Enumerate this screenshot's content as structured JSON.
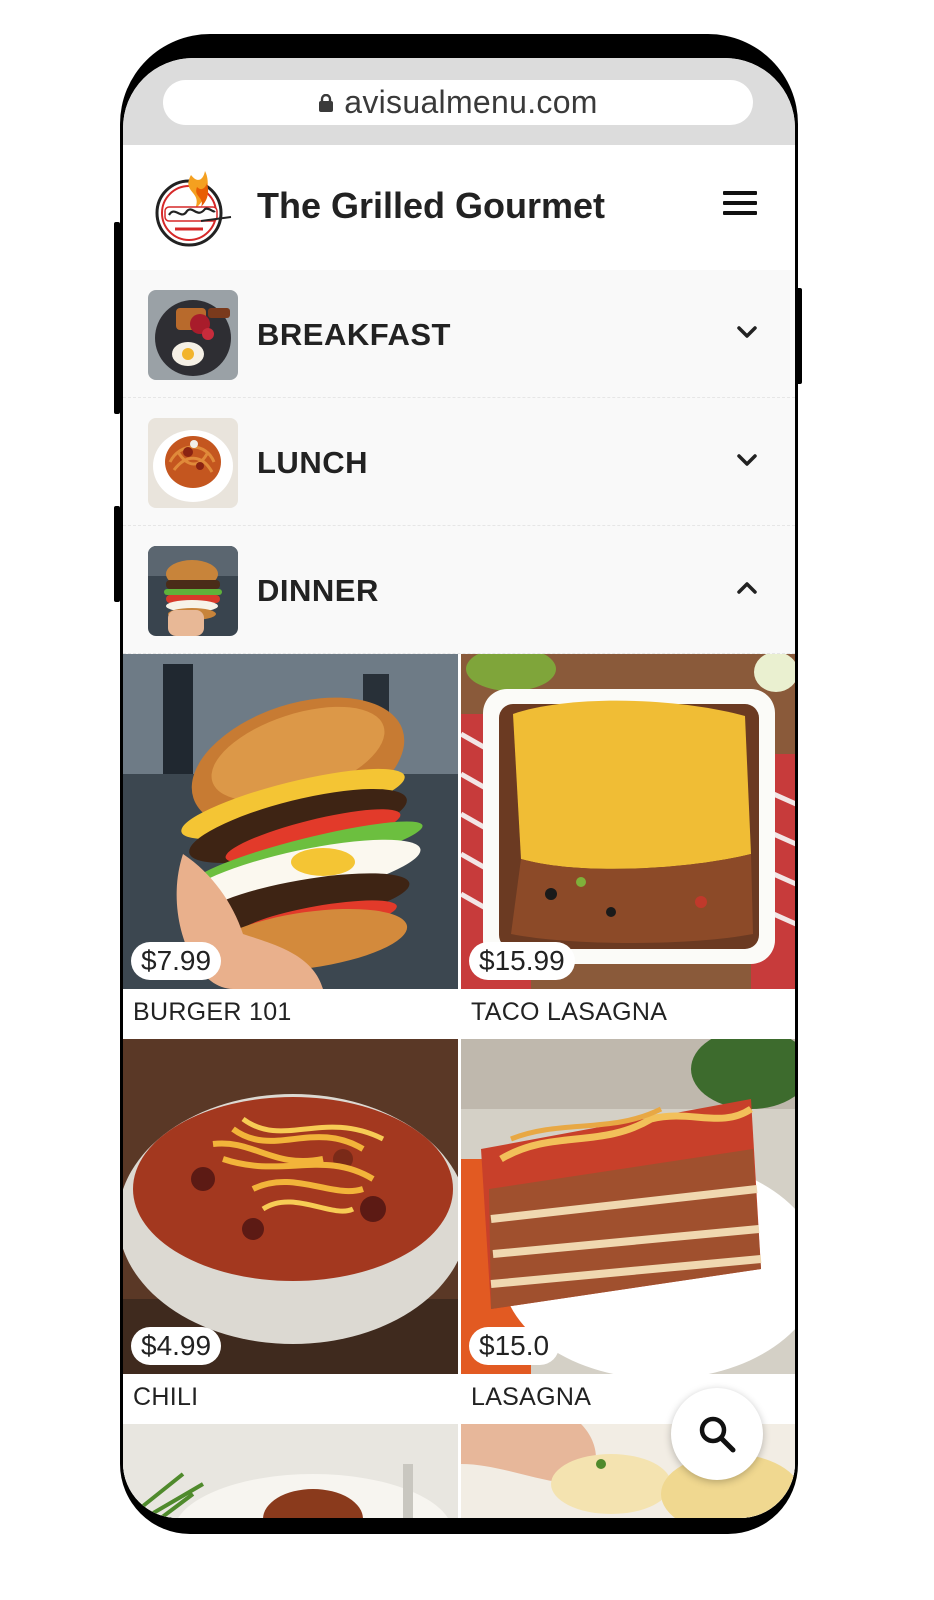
{
  "browser": {
    "url": "avisualmenu.com"
  },
  "header": {
    "title": "The Grilled Gourmet"
  },
  "categories": [
    {
      "label": "BREAKFAST",
      "expanded": false
    },
    {
      "label": "LUNCH",
      "expanded": false
    },
    {
      "label": "DINNER",
      "expanded": true
    }
  ],
  "items": [
    {
      "name": "BURGER 101",
      "price": "$7.99"
    },
    {
      "name": "TACO LASAGNA",
      "price": "$15.99"
    },
    {
      "name": "CHILI",
      "price": "$4.99"
    },
    {
      "name": "LASAGNA",
      "price": "$15.0"
    }
  ],
  "icons": {
    "lock": "lock-icon",
    "menu": "hamburger-menu-icon",
    "chevron_down": "chevron-down-icon",
    "chevron_up": "chevron-up-icon",
    "search": "search-icon"
  },
  "colors": {
    "browser_bar": "#dcdcdc",
    "category_bg": "#f9f9f9",
    "text": "#222222"
  }
}
